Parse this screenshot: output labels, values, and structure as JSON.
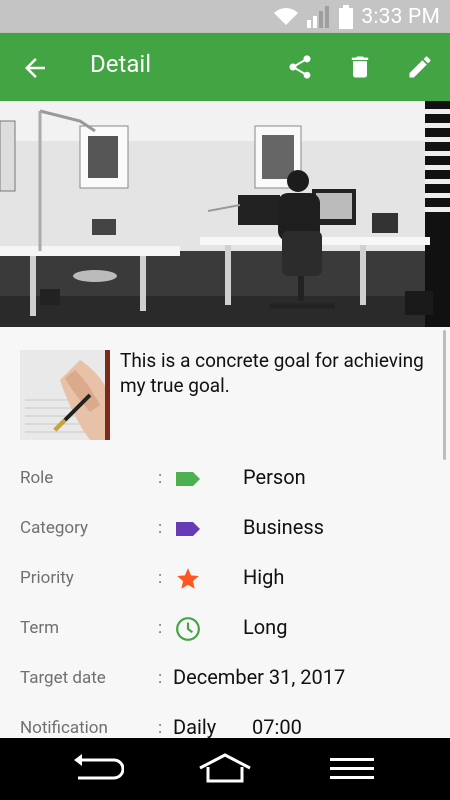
{
  "statusbar": {
    "time": "3:33 PM"
  },
  "appbar": {
    "title": "Detail"
  },
  "goal": {
    "description": "This is a concrete goal for achieving my true goal."
  },
  "details": {
    "role": {
      "label": "Role",
      "value": "Person"
    },
    "category": {
      "label": "Category",
      "value": "Business"
    },
    "priority": {
      "label": "Priority",
      "value": "High"
    },
    "term": {
      "label": "Term",
      "value": "Long"
    },
    "target_date": {
      "label": "Target date",
      "value": "December 31, 2017"
    },
    "notification": {
      "label": "Notification",
      "frequency": "Daily",
      "time": "07:00"
    }
  },
  "colors": {
    "appbar": "#43a443",
    "role_tag": "#4caf50",
    "category_tag": "#673ab7",
    "priority_star": "#ff5722",
    "term_clock": "#43a443"
  },
  "separator": ":"
}
